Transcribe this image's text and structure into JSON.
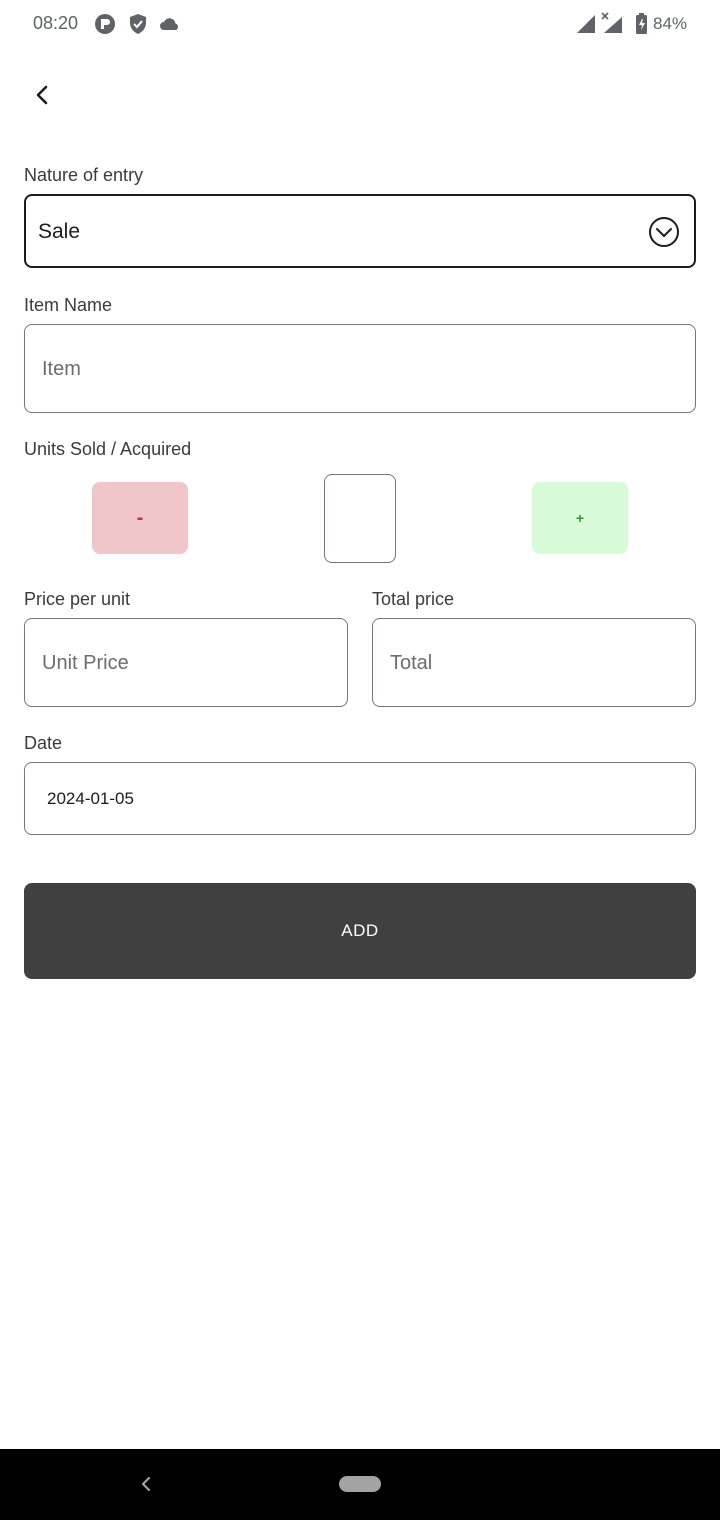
{
  "status_bar": {
    "time": "08:20",
    "battery_percent": "84%",
    "icons": [
      "app-circle-icon",
      "shield-icon",
      "cloud-icon",
      "signal-icon",
      "signal-x-icon",
      "battery-charging-icon"
    ]
  },
  "header": {
    "back_icon": "chevron-left-icon"
  },
  "form": {
    "nature_label": "Nature of entry",
    "nature_value": "Sale",
    "item_name_label": "Item Name",
    "item_placeholder": "Item",
    "units_label": "Units Sold / Acquired",
    "minus_label": "-",
    "plus_label": "+",
    "quantity_value": "",
    "price_label": "Price per unit",
    "price_placeholder": "Unit Price",
    "total_label": "Total price",
    "total_placeholder": "Total",
    "date_label": "Date",
    "date_value": "2024-01-05",
    "add_label": "ADD"
  },
  "colors": {
    "minus_bg": "#f0c6c8",
    "minus_fg": "#c8322e",
    "plus_bg": "#d6fbd6",
    "plus_fg": "#2f9a2f",
    "add_bg": "#404040"
  }
}
